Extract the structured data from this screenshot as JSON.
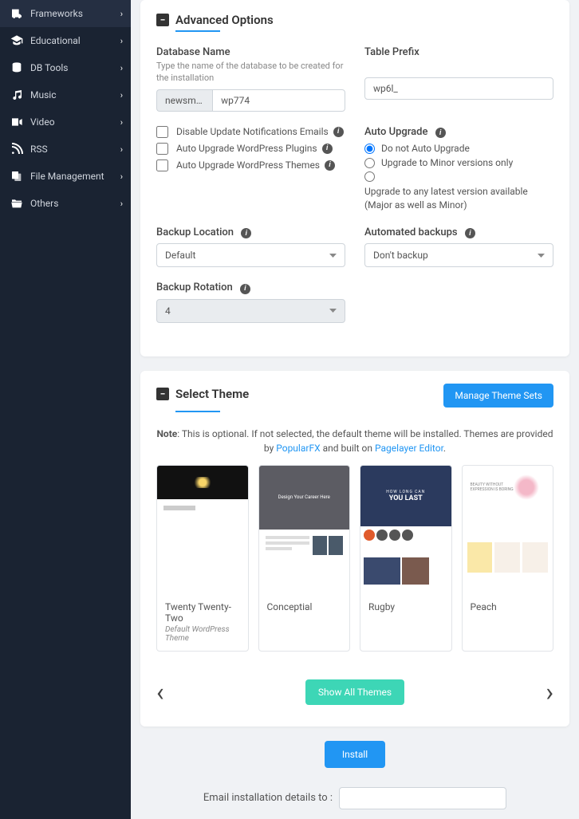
{
  "sidebar": {
    "items": [
      {
        "label": "Frameworks",
        "icon": "truck"
      },
      {
        "label": "Educational",
        "icon": "grad"
      },
      {
        "label": "DB Tools",
        "icon": "db"
      },
      {
        "label": "Music",
        "icon": "music"
      },
      {
        "label": "Video",
        "icon": "video"
      },
      {
        "label": "RSS",
        "icon": "rss"
      },
      {
        "label": "File Management",
        "icon": "file"
      },
      {
        "label": "Others",
        "icon": "folder"
      }
    ]
  },
  "advanced": {
    "title": "Advanced Options",
    "db_name_label": "Database Name",
    "db_name_hint": "Type the name of the database to be created for the installation",
    "db_prefix": "newsmashal_",
    "db_value": "wp774",
    "table_prefix_label": "Table Prefix",
    "table_prefix_value": "wp6l_",
    "cb1": "Disable Update Notifications Emails",
    "cb2": "Auto Upgrade WordPress Plugins",
    "cb3": "Auto Upgrade WordPress Themes",
    "auto_upgrade_label": "Auto Upgrade",
    "radio1": "Do not Auto Upgrade",
    "radio2": "Upgrade to Minor versions only",
    "radio3": "Upgrade to any latest version available (Major as well as Minor)",
    "backup_location_label": "Backup Location",
    "backup_location_value": "Default",
    "automated_backups_label": "Automated backups",
    "automated_backups_value": "Don't backup",
    "backup_rotation_label": "Backup Rotation",
    "backup_rotation_value": "4"
  },
  "themes": {
    "title": "Select Theme",
    "manage_btn": "Manage Theme Sets",
    "note_bold": "Note",
    "note_text": ": This is optional. If not selected, the default theme will be installed. Themes are provided by ",
    "note_link1": "PopularFX",
    "note_mid": " and built on ",
    "note_link2": "Pagelayer Editor",
    "cards": [
      {
        "name": "Twenty Twenty-Two",
        "sub": "Default WordPress Theme"
      },
      {
        "name": "Conceptial"
      },
      {
        "name": "Rugby",
        "top_small": "HOW LONG CAN",
        "top_big": "YOU LAST"
      },
      {
        "name": "Peach"
      }
    ],
    "show_all": "Show All Themes"
  },
  "install": {
    "btn": "Install",
    "email_label": "Email installation details to :"
  }
}
